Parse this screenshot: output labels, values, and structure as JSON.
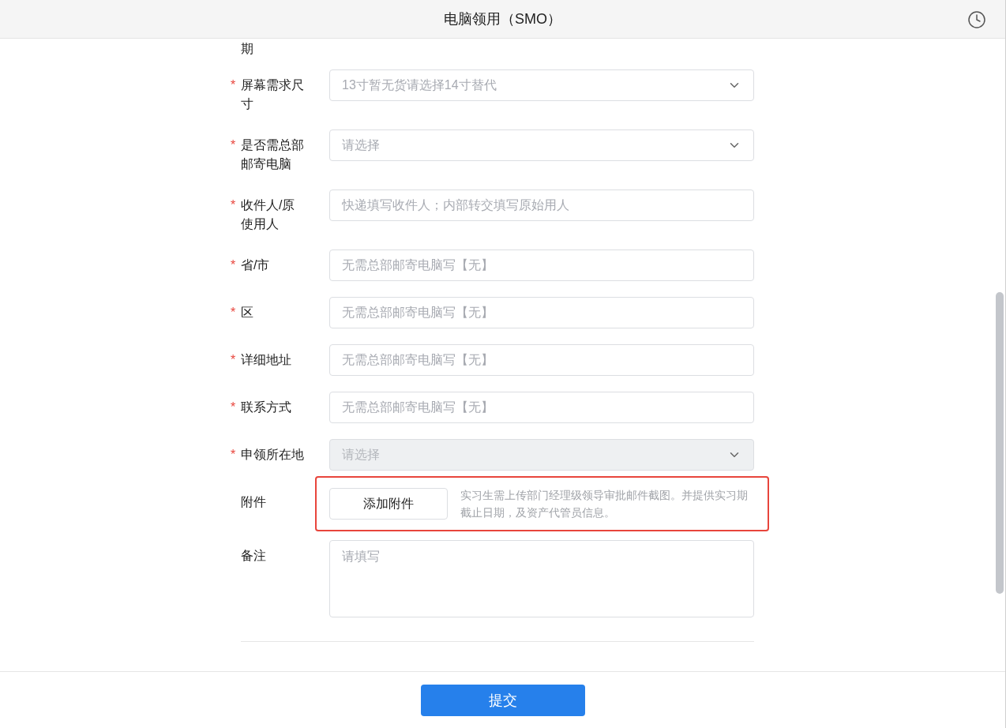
{
  "header": {
    "title": "电脑领用（SMO）"
  },
  "cut_label": "期",
  "fields": [
    {
      "label": "屏幕需求尺寸",
      "required_mark": "*",
      "kind": "select",
      "placeholder": "13寸暂无货请选择14寸替代",
      "disabled": false
    },
    {
      "label": "是否需总部邮寄电脑",
      "required_mark": "*",
      "kind": "select",
      "placeholder": "请选择",
      "disabled": false
    },
    {
      "label": "收件人/原使用人",
      "required_mark": "*",
      "kind": "input",
      "placeholder": "快递填写收件人；内部转交填写原始用人",
      "disabled": false
    },
    {
      "label": "省/市",
      "required_mark": "*",
      "kind": "input",
      "placeholder": "无需总部邮寄电脑写【无】",
      "disabled": false
    },
    {
      "label": "区",
      "required_mark": "*",
      "kind": "input",
      "placeholder": "无需总部邮寄电脑写【无】",
      "disabled": false
    },
    {
      "label": "详细地址",
      "required_mark": "*",
      "kind": "input",
      "placeholder": "无需总部邮寄电脑写【无】",
      "disabled": false
    },
    {
      "label": "联系方式",
      "required_mark": "*",
      "kind": "input",
      "placeholder": "无需总部邮寄电脑写【无】",
      "disabled": false
    },
    {
      "label": "申领所在地",
      "required_mark": "*",
      "kind": "select",
      "placeholder": "请选择",
      "disabled": true
    },
    {
      "label": "附件",
      "kind": "upload",
      "button": "添加附件",
      "hint": "实习生需上传部门经理级领导审批邮件截图。并提供实习期截止日期，及资产代管员信息。",
      "highlighted": true
    },
    {
      "label": "备注",
      "kind": "textarea",
      "placeholder": "请填写",
      "disabled": false
    }
  ],
  "submit": "提交"
}
